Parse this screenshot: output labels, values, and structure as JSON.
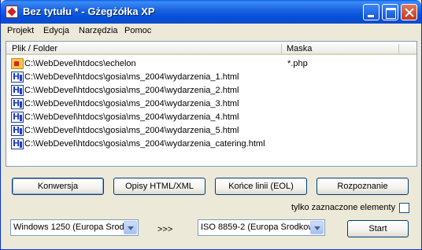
{
  "window": {
    "title": "Bez tytułu * - Gżegżółka XP"
  },
  "menu": [
    "Projekt",
    "Edycja",
    "Narzędzia",
    "Pomoc"
  ],
  "list": {
    "columns": {
      "file": "Plik / Folder",
      "mask": "Maska"
    },
    "rows": [
      {
        "icon": "folder-icon",
        "path": "C:\\WebDevel\\htdocs\\echelon",
        "mask": "*.php"
      },
      {
        "icon": "html-file-icon",
        "path": "C:\\WebDevel\\htdocs\\gosia\\ms_2004\\wydarzenia_1.html",
        "mask": ""
      },
      {
        "icon": "html-file-icon",
        "path": "C:\\WebDevel\\htdocs\\gosia\\ms_2004\\wydarzenia_2.html",
        "mask": ""
      },
      {
        "icon": "html-file-icon",
        "path": "C:\\WebDevel\\htdocs\\gosia\\ms_2004\\wydarzenia_3.html",
        "mask": ""
      },
      {
        "icon": "html-file-icon",
        "path": "C:\\WebDevel\\htdocs\\gosia\\ms_2004\\wydarzenia_4.html",
        "mask": ""
      },
      {
        "icon": "html-file-icon",
        "path": "C:\\WebDevel\\htdocs\\gosia\\ms_2004\\wydarzenia_5.html",
        "mask": ""
      },
      {
        "icon": "html-file-icon",
        "path": "C:\\WebDevel\\htdocs\\gosia\\ms_2004\\wydarzenia_catering.html",
        "mask": ""
      }
    ]
  },
  "buttons": {
    "convert": "Konwersja",
    "html_xml": "Opisy HTML/XML",
    "eol": "Końce linii (EOL)",
    "recognize": "Rozpoznanie",
    "start": "Start"
  },
  "selected_only": {
    "label": "tylko zaznaczone elementy",
    "checked": false
  },
  "source_encoding": "Windows 1250 (Europa Środk",
  "arrows": ">>>",
  "target_encoding": "ISO 8859-2 (Europa Środkow"
}
